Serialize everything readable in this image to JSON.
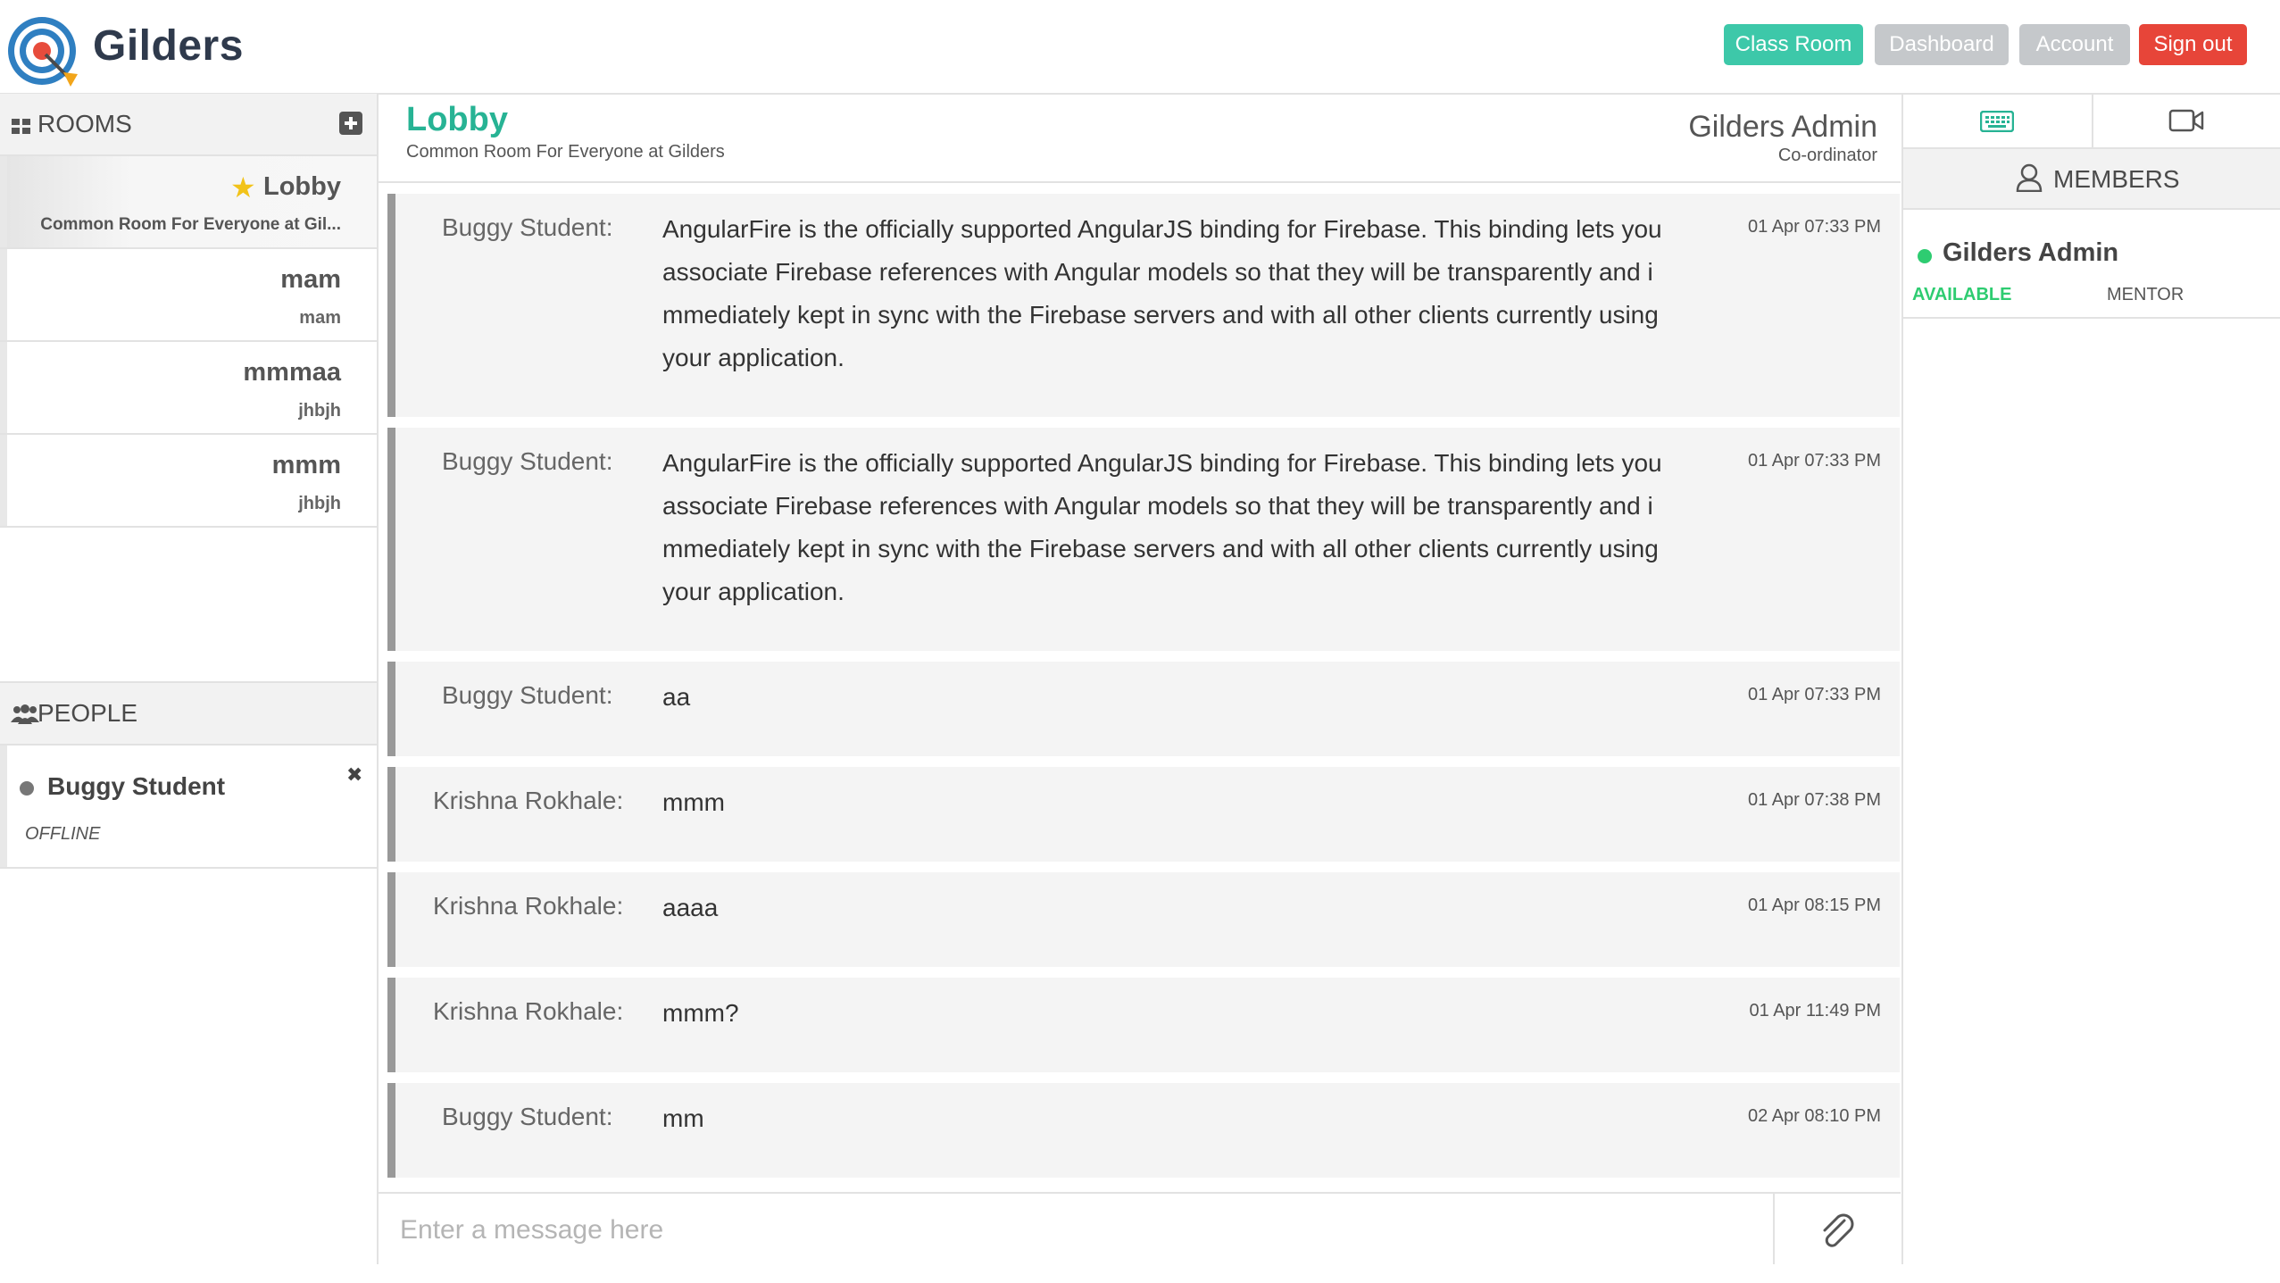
{
  "app": {
    "title": "Gilders"
  },
  "nav": {
    "classroom": "Class Room",
    "dashboard": "Dashboard",
    "account": "Account",
    "signout": "Sign out"
  },
  "sidebar": {
    "rooms_title": "ROOMS",
    "rooms": [
      {
        "name": "Lobby",
        "subtitle": "Common Room For Everyone at Gil..."
      },
      {
        "name": "mam",
        "subtitle": "mam"
      },
      {
        "name": "mmmaa",
        "subtitle": "jhbjh"
      },
      {
        "name": "mmm",
        "subtitle": "jhbjh"
      }
    ],
    "people_title": "PEOPLE",
    "people": [
      {
        "name": "Buggy Student",
        "status": "OFFLINE"
      }
    ]
  },
  "room": {
    "title": "Lobby",
    "description": "Common Room For Everyone at Gilders",
    "admin_name": "Gilders Admin",
    "admin_role": "Co-ordinator"
  },
  "messages": [
    {
      "author": "Buggy Student:",
      "text": "AngularFire is the officially supported AngularJS binding for Firebase. This binding lets you associate Firebase references with Angular models so that they will be transparently and immediately kept in sync with the Firebase servers and with all other clients currently using your application.",
      "time": "01 Apr 07:33 PM"
    },
    {
      "author": "Buggy Student:",
      "text": "AngularFire is the officially supported AngularJS binding for Firebase. This binding lets you associate Firebase references with Angular models so that they will be transparently and immediately kept in sync with the Firebase servers and with all other clients currently using your application.",
      "time": "01 Apr 07:33 PM"
    },
    {
      "author": "Buggy Student:",
      "text": "aa",
      "time": "01 Apr 07:33 PM"
    },
    {
      "author": "Krishna Rokhale:",
      "text": "mmm",
      "time": "01 Apr 07:38 PM"
    },
    {
      "author": "Krishna Rokhale:",
      "text": "aaaa",
      "time": "01 Apr 08:15 PM"
    },
    {
      "author": "Krishna Rokhale:",
      "text": "mmm?",
      "time": "01 Apr 11:49 PM"
    },
    {
      "author": "Buggy Student:",
      "text": "mm",
      "time": "02 Apr 08:10 PM"
    }
  ],
  "composer": {
    "placeholder": "Enter a message here"
  },
  "members_panel": {
    "title": "MEMBERS",
    "members": [
      {
        "name": "Gilders Admin",
        "status": "AVAILABLE",
        "role": "MENTOR"
      }
    ]
  },
  "colors": {
    "brand_green": "#27b394",
    "classroom_button": "#3dc8a9",
    "signout_button": "#e74539",
    "inactive_button": "#c5c8cb",
    "available": "#2ecc71"
  }
}
